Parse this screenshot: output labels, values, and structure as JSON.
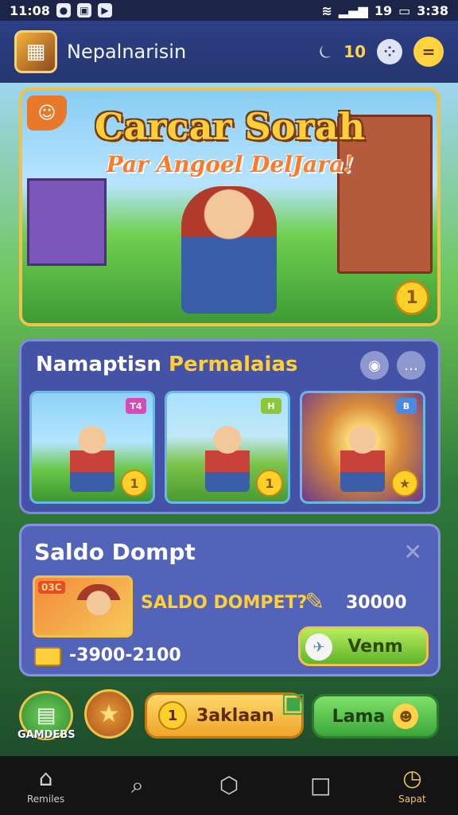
{
  "status_bar": {
    "time_left": "11:08",
    "time_right": "3:38",
    "signal_text": "19"
  },
  "header": {
    "app_name": "Nepalnarisin",
    "coin_count": "10",
    "icons": [
      "app-logo-icon",
      "bell-icon",
      "gamepad-icon",
      "menu-icon"
    ]
  },
  "hero": {
    "title": "Carcar Sorah",
    "subtitle": "Par Angoel DelJara!"
  },
  "promos": {
    "heading_part1": "Namaptisn",
    "heading_part2": "Permalaias",
    "cards": [
      {
        "name": "card-1",
        "tag": "T4"
      },
      {
        "name": "card-2",
        "tag": "H"
      },
      {
        "name": "card-3",
        "tag": "B"
      }
    ]
  },
  "wallet": {
    "title": "Saldo Dompt",
    "badge_text": "03C",
    "question": "SALDO DOMPET?",
    "amount": "30000",
    "range": "-3900-2100",
    "button_label": "Venm"
  },
  "actions": {
    "game_label": "GAMDEBS",
    "primary_label": "3aklaan",
    "secondary_label": "Lama"
  },
  "bottom_nav": {
    "items": [
      {
        "label": "Remiles",
        "icon": "home-icon"
      },
      {
        "label": "",
        "icon": "search-icon"
      },
      {
        "label": "",
        "icon": "circle-home-icon"
      },
      {
        "label": "",
        "icon": "square-icon"
      },
      {
        "label": "Sapat",
        "icon": "clock-icon"
      }
    ]
  },
  "colors": {
    "header_bg": "#2d3f86",
    "accent_gold": "#ffcf3a",
    "panel_bg": "#4553a6",
    "button_green": "#5fb42c"
  }
}
